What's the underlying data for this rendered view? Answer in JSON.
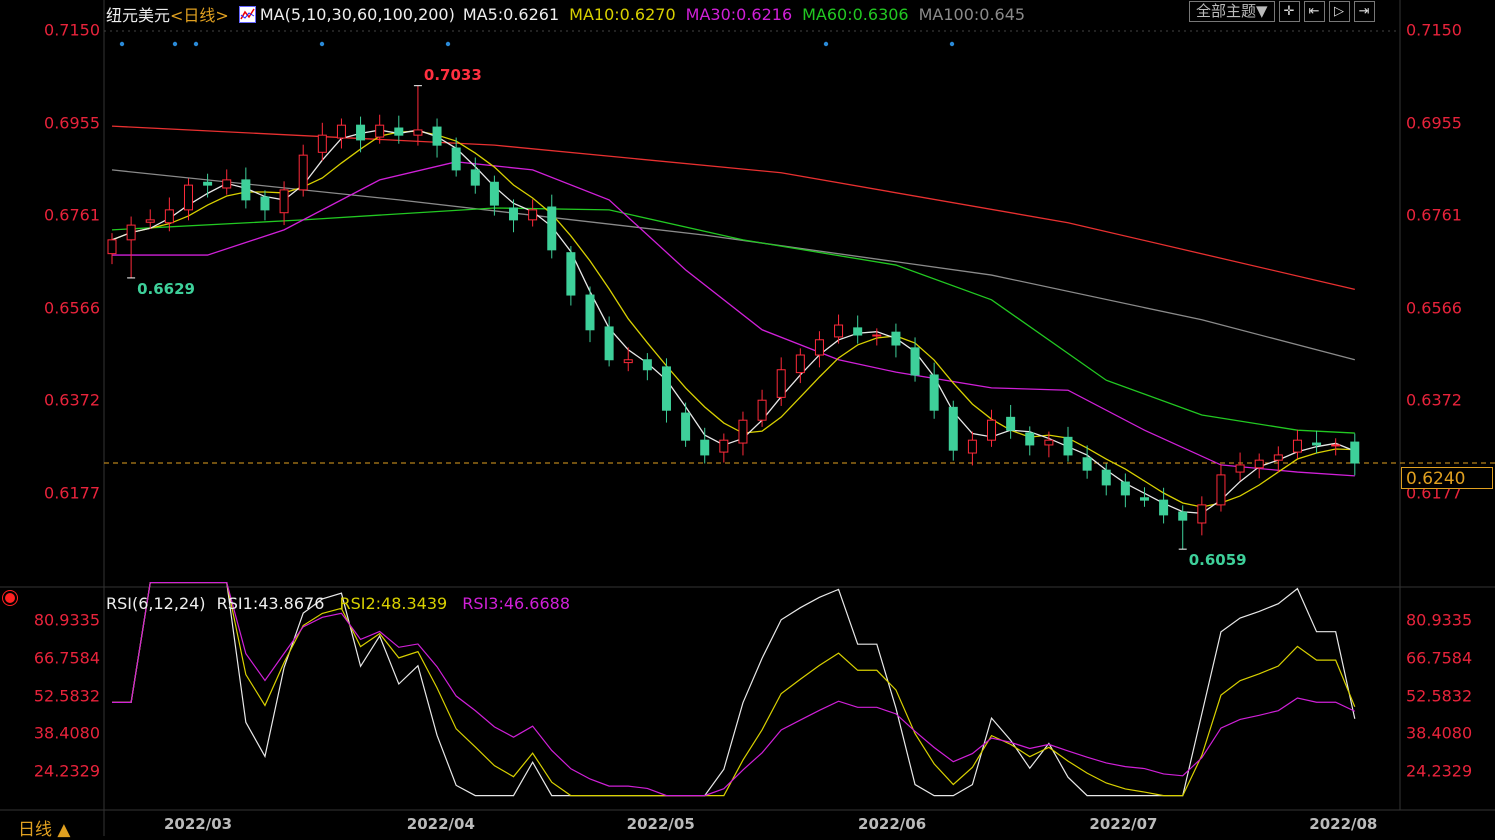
{
  "header": {
    "symbol": "纽元美元",
    "period_tag": "<日线>",
    "ma_label": "MA(5,10,30,60,100,200)",
    "ma5": "MA5:0.6261",
    "ma10": "MA10:0.6270",
    "ma30": "MA30:0.6216",
    "ma60": "MA60:0.6306",
    "ma100": "MA100:0.645"
  },
  "toolbar": {
    "theme_button": "全部主题▼",
    "icons": [
      "crosshair-icon",
      "range-icon",
      "play-icon",
      "exit-icon"
    ],
    "icon_glyphs": [
      "✛",
      "⇤",
      "▷",
      "⇥"
    ]
  },
  "rsi_header": {
    "label": "RSI(6,12,24)",
    "rsi1": "RSI1:43.8676",
    "rsi2": "RSI2:48.3439",
    "rsi3": "RSI3:46.6688"
  },
  "period_label": "日线 ▲",
  "current_price": "0.6240",
  "colors": {
    "up": "#ff2a3a",
    "down": "#3ed09a",
    "ma5": "#e8e8e8",
    "ma10": "#d8d000",
    "ma30": "#d020d8",
    "ma60": "#22c822",
    "ma100": "#8a8a8a",
    "ma200": "#e83030",
    "axis": "#e8233b"
  },
  "chart_data": [
    {
      "type": "candlestick",
      "title": "纽元美元 日线",
      "y_ticks": [
        "0.7150",
        "0.6955",
        "0.6761",
        "0.6566",
        "0.6372",
        "0.6177"
      ],
      "ylim": [
        0.608,
        0.715
      ],
      "x_ticks": [
        "2022/03",
        "2022/04",
        "2022/05",
        "2022/06",
        "2022/07",
        "2022/08"
      ],
      "x_tick_index": [
        4.5,
        17.2,
        28.7,
        40.8,
        52.9,
        64.4
      ],
      "first_open": 0.668,
      "closes": [
        0.6709,
        0.674,
        0.6751,
        0.6772,
        0.6824,
        0.6824,
        0.6835,
        0.6793,
        0.6772,
        0.6814,
        0.6887,
        0.6929,
        0.695,
        0.6919,
        0.695,
        0.6929,
        0.694,
        0.6908,
        0.6856,
        0.6824,
        0.6782,
        0.6751,
        0.6772,
        0.6688,
        0.6593,
        0.652,
        0.6457,
        0.6457,
        0.6436,
        0.6351,
        0.6288,
        0.6257,
        0.6288,
        0.633,
        0.6372,
        0.6436,
        0.6467,
        0.6499,
        0.653,
        0.6509,
        0.6509,
        0.6488,
        0.6425,
        0.6351,
        0.6267,
        0.6288,
        0.633,
        0.6309,
        0.6278,
        0.6288,
        0.6257,
        0.6225,
        0.6194,
        0.6173,
        0.6162,
        0.6131,
        0.612,
        0.6152,
        0.6215,
        0.6236,
        0.6246,
        0.6257,
        0.6288,
        0.6278,
        0.6278,
        0.624
      ],
      "annotations": [
        {
          "index": 16,
          "price": 0.7033,
          "text": "0.7033",
          "kind": "high"
        },
        {
          "index": 1,
          "price": 0.6629,
          "text": "0.6629",
          "kind": "low"
        },
        {
          "index": 56,
          "price": 0.6059,
          "text": "0.6059",
          "kind": "low"
        }
      ],
      "ma_lines": {
        "MA200": [
          [
            0,
            0.6948
          ],
          [
            20,
            0.6908
          ],
          [
            35,
            0.685
          ],
          [
            50,
            0.6745
          ],
          [
            65,
            0.6605
          ]
        ],
        "MA100": [
          [
            0,
            0.6856
          ],
          [
            15,
            0.6793
          ],
          [
            31,
            0.6719
          ],
          [
            46,
            0.6635
          ],
          [
            57,
            0.6541
          ],
          [
            65,
            0.6457
          ]
        ],
        "MA60": [
          [
            0,
            0.673
          ],
          [
            10,
            0.6751
          ],
          [
            20,
            0.6776
          ],
          [
            26,
            0.6772
          ],
          [
            33,
            0.6709
          ],
          [
            41,
            0.6656
          ],
          [
            46,
            0.6583
          ],
          [
            52,
            0.6414
          ],
          [
            57,
            0.6341
          ],
          [
            62,
            0.6309
          ],
          [
            65,
            0.6303
          ]
        ],
        "MA30": [
          [
            0,
            0.6677
          ],
          [
            5,
            0.6677
          ],
          [
            9,
            0.673
          ],
          [
            14,
            0.6835
          ],
          [
            18,
            0.6873
          ],
          [
            22,
            0.6856
          ],
          [
            26,
            0.6793
          ],
          [
            30,
            0.6646
          ],
          [
            34,
            0.652
          ],
          [
            38,
            0.6457
          ],
          [
            41,
            0.6431
          ],
          [
            46,
            0.6398
          ],
          [
            50,
            0.6393
          ],
          [
            54,
            0.6309
          ],
          [
            58,
            0.6236
          ],
          [
            62,
            0.6221
          ],
          [
            65,
            0.6213
          ]
        ]
      }
    },
    {
      "type": "line",
      "title": "RSI(6,12,24)",
      "y_ticks": [
        "80.9335",
        "66.7584",
        "52.5832",
        "38.4080",
        "24.2329"
      ],
      "series": [
        "RSI1",
        "RSI2",
        "RSI3"
      ],
      "last_values": [
        43.8676,
        48.3439,
        46.6688
      ]
    }
  ]
}
